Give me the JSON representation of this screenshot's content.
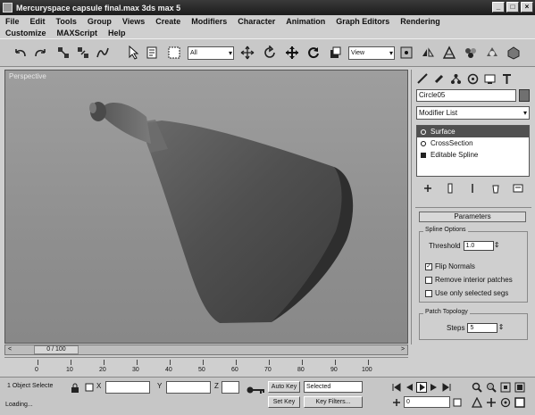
{
  "window": {
    "title": "Mercuryspace capsule  final.max  3ds max 5",
    "buttons": [
      "_",
      "□",
      "×"
    ]
  },
  "menubar": {
    "row1": [
      "File",
      "Edit",
      "Tools",
      "Group",
      "Views",
      "Create",
      "Modifiers",
      "Character",
      "Animation",
      "Graph Editors",
      "Rendering"
    ],
    "row2": [
      "Customize",
      "MAXScript",
      "Help"
    ]
  },
  "toolbar": {
    "selection_filter": "All",
    "ref_coord": "View"
  },
  "viewport": {
    "label": "Perspective"
  },
  "command_panel": {
    "object_name": "Circle05",
    "modifier_list": "Modifier List",
    "stack": [
      {
        "label": "Surface",
        "selected": true
      },
      {
        "label": "CrossSection",
        "selected": false
      },
      {
        "label": "Editable Spline",
        "selected": false
      }
    ],
    "rollout_title": "Parameters",
    "spline_options": {
      "group_label": "Spline Options",
      "threshold_label": "Threshold",
      "threshold_value": "1.0",
      "flip_normals_label": "Flip Normals",
      "flip_normals_checked": true,
      "remove_interior_label": "Remove interior patches",
      "use_selected_label": "Use only selected segs"
    },
    "patch_topology": {
      "group_label": "Patch Topology",
      "steps_label": "Steps",
      "steps_value": "5"
    }
  },
  "time_slider": {
    "frame_label": "0 / 100"
  },
  "track_bar": {
    "ticks": [
      "0",
      "10",
      "20",
      "30",
      "40",
      "50",
      "60",
      "70",
      "80",
      "90",
      "100"
    ]
  },
  "status": {
    "selection": "1 Object Selecte",
    "x_label": "X",
    "y_label": "Y",
    "z_label": "Z",
    "prompt": "Loading...",
    "auto_key": "Auto Key",
    "set_key": "Set Key",
    "key_mode": "Selected",
    "key_filters": "Key Filters...",
    "frame": "0"
  }
}
